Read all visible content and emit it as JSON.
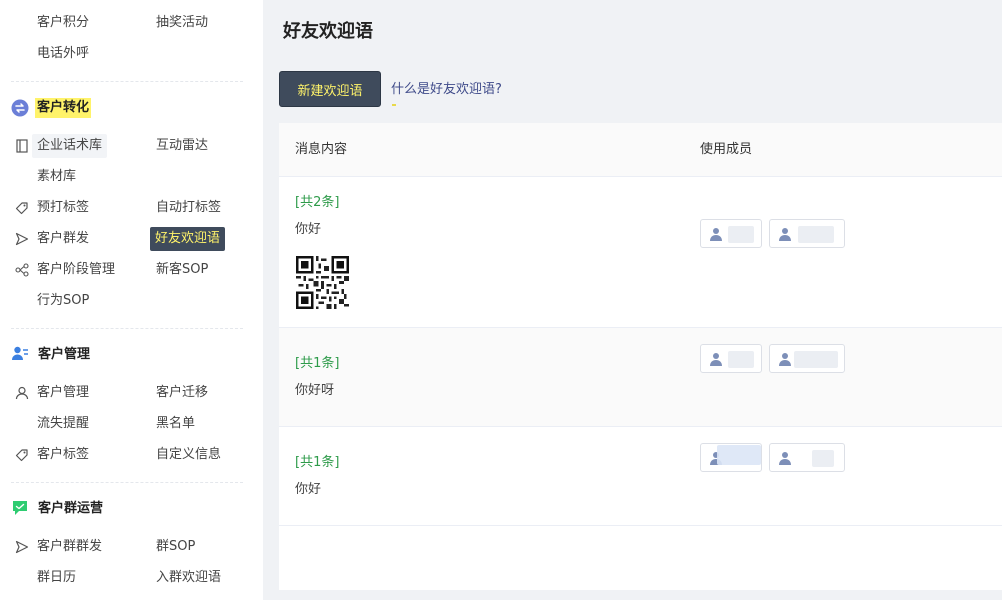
{
  "sidebar": {
    "top": {
      "customer_points": "客户积分",
      "lottery": "抽奖活动",
      "phone_call": "电话外呼"
    },
    "conversion": {
      "title": "客户转化",
      "script_library": "企业话术库",
      "interaction_radar": "互动雷达",
      "material_library": "素材库",
      "pre_tag": "预打标签",
      "auto_tag": "自动打标签",
      "customer_mass_send": "客户群发",
      "friend_welcome": "好友欢迎语",
      "stage_management": "客户阶段管理",
      "new_customer_sop": "新客SOP",
      "behavior_sop": "行为SOP"
    },
    "management": {
      "title": "客户管理",
      "customer_management": "客户管理",
      "customer_migration": "客户迁移",
      "churn_reminder": "流失提醒",
      "blacklist": "黑名单",
      "customer_tags": "客户标签",
      "custom_info": "自定义信息"
    },
    "group_ops": {
      "title": "客户群运营",
      "group_mass_send": "客户群群发",
      "group_sop": "群SOP",
      "group_calendar": "群日历",
      "group_welcome": "入群欢迎语"
    }
  },
  "main": {
    "title": "好友欢迎语",
    "new_button": "新建欢迎语",
    "help_link": "什么是好友欢迎语?",
    "table": {
      "columns": [
        "消息内容",
        "使用成员"
      ],
      "rows": [
        {
          "count": "[共2条]",
          "message": "你好"
        },
        {
          "count": "[共1条]",
          "message": "你好呀"
        },
        {
          "count": "[共1条]",
          "message": "你好"
        }
      ]
    }
  },
  "colors": {
    "accent_dark": "#3f4b5c",
    "highlight_yellow": "#fff36a",
    "count_green": "#2e9b4a",
    "link_blue": "#3f4b8a"
  },
  "icons": [
    "book-icon",
    "tag-icon",
    "send-icon",
    "stage-icon",
    "user-icon",
    "convert-icon",
    "manage-icon",
    "chat-icon",
    "qr-code-icon",
    "member-icon"
  ]
}
